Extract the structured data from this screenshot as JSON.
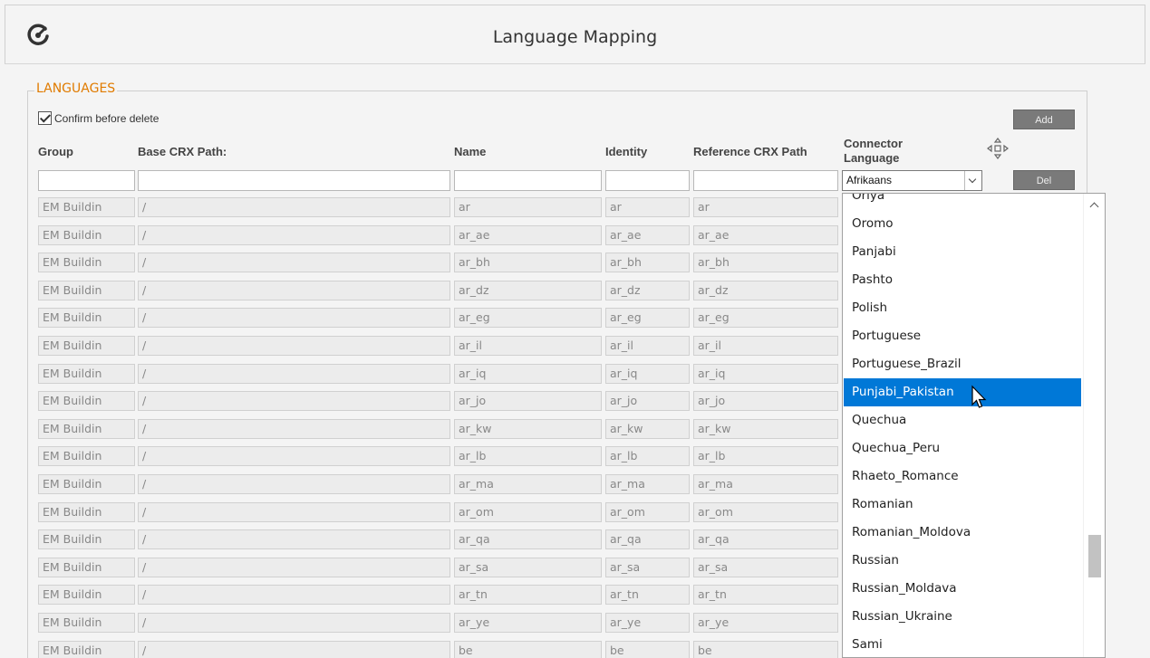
{
  "window": {
    "title": "Language Mapping"
  },
  "fieldset": {
    "legend": "LANGUAGES"
  },
  "confirm": {
    "label": "Confirm before delete",
    "checked": true
  },
  "buttons": {
    "add": "Add",
    "del": "Del"
  },
  "columns": [
    "Group",
    "Base CRX Path:",
    "Name",
    "Identity",
    "Reference CRX Path",
    "Connector Language"
  ],
  "connector_select": {
    "value": "Afrikaans"
  },
  "rows": [
    {
      "group": "EM Buildin",
      "base": "/",
      "name": "ar",
      "identity": "ar",
      "ref": "ar"
    },
    {
      "group": "EM Buildin",
      "base": "/",
      "name": "ar_ae",
      "identity": "ar_ae",
      "ref": "ar_ae"
    },
    {
      "group": "EM Buildin",
      "base": "/",
      "name": "ar_bh",
      "identity": "ar_bh",
      "ref": "ar_bh"
    },
    {
      "group": "EM Buildin",
      "base": "/",
      "name": "ar_dz",
      "identity": "ar_dz",
      "ref": "ar_dz"
    },
    {
      "group": "EM Buildin",
      "base": "/",
      "name": "ar_eg",
      "identity": "ar_eg",
      "ref": "ar_eg"
    },
    {
      "group": "EM Buildin",
      "base": "/",
      "name": "ar_il",
      "identity": "ar_il",
      "ref": "ar_il"
    },
    {
      "group": "EM Buildin",
      "base": "/",
      "name": "ar_iq",
      "identity": "ar_iq",
      "ref": "ar_iq"
    },
    {
      "group": "EM Buildin",
      "base": "/",
      "name": "ar_jo",
      "identity": "ar_jo",
      "ref": "ar_jo"
    },
    {
      "group": "EM Buildin",
      "base": "/",
      "name": "ar_kw",
      "identity": "ar_kw",
      "ref": "ar_kw"
    },
    {
      "group": "EM Buildin",
      "base": "/",
      "name": "ar_lb",
      "identity": "ar_lb",
      "ref": "ar_lb"
    },
    {
      "group": "EM Buildin",
      "base": "/",
      "name": "ar_ma",
      "identity": "ar_ma",
      "ref": "ar_ma"
    },
    {
      "group": "EM Buildin",
      "base": "/",
      "name": "ar_om",
      "identity": "ar_om",
      "ref": "ar_om"
    },
    {
      "group": "EM Buildin",
      "base": "/",
      "name": "ar_qa",
      "identity": "ar_qa",
      "ref": "ar_qa"
    },
    {
      "group": "EM Buildin",
      "base": "/",
      "name": "ar_sa",
      "identity": "ar_sa",
      "ref": "ar_sa"
    },
    {
      "group": "EM Buildin",
      "base": "/",
      "name": "ar_tn",
      "identity": "ar_tn",
      "ref": "ar_tn"
    },
    {
      "group": "EM Buildin",
      "base": "/",
      "name": "ar_ye",
      "identity": "ar_ye",
      "ref": "ar_ye"
    },
    {
      "group": "EM Buildin",
      "base": "/",
      "name": "be",
      "identity": "be",
      "ref": "be"
    }
  ],
  "dropdown": {
    "items": [
      "Oriya",
      "Oromo",
      "Panjabi",
      "Pashto",
      "Polish",
      "Portuguese",
      "Portuguese_Brazil",
      "Punjabi_Pakistan",
      "Quechua",
      "Quechua_Peru",
      "Rhaeto_Romance",
      "Romanian",
      "Romanian_Moldova",
      "Russian",
      "Russian_Moldava",
      "Russian_Ukraine",
      "Sami"
    ],
    "highlighted": "Punjabi_Pakistan"
  },
  "colors": {
    "accent": "#e07b00",
    "selection": "#0078d7"
  }
}
